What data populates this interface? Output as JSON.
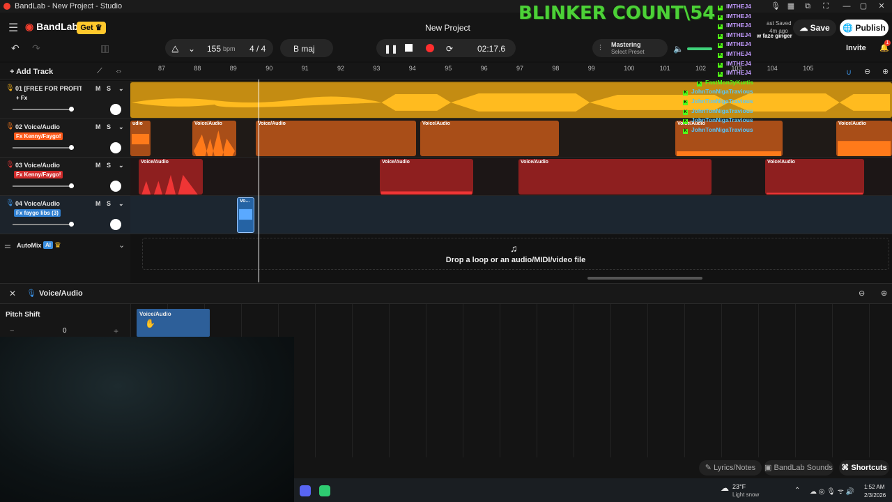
{
  "window": {
    "title": "BandLab - New Project - Studio",
    "min": "—",
    "max": "▢",
    "close": "✕"
  },
  "header": {
    "logo": "BandLab",
    "get_label": "Get",
    "project_title": "New Project",
    "save_label": "Save",
    "publish_label": "Publish",
    "invite_label": "Invite",
    "notif_count": "1",
    "saved_text": "ast Saved",
    "saved_time": "4m ago"
  },
  "transport": {
    "tempo": "155",
    "tempo_unit": "bpm",
    "time_sig": "4 / 4",
    "key": "B maj",
    "time": "02:17.6",
    "mastering_title": "Mastering",
    "mastering_sub": "Select Preset"
  },
  "ruler": {
    "add_track": "Add Track",
    "bars": [
      "87",
      "88",
      "89",
      "90",
      "91",
      "92",
      "93",
      "94",
      "95",
      "96",
      "97",
      "98",
      "99",
      "100",
      "101",
      "102",
      "103",
      "104",
      "105"
    ]
  },
  "tracks": [
    {
      "name": "01  [FREE FOR PROFIT] ...",
      "fx": "+ Fx",
      "color": "#f5b21a",
      "m": "M",
      "s": "S"
    },
    {
      "name": "02  Voice/Audio",
      "fx": "Fx  Kenny/Faygo!",
      "color": "#ff7a1a",
      "m": "M",
      "s": "S"
    },
    {
      "name": "03  Voice/Audio",
      "fx": "Fx  Kenny/Faygo!",
      "color": "#e23434",
      "m": "M",
      "s": "S"
    },
    {
      "name": "04  Voice/Audio",
      "fx": "Fx  faygo libs (3)",
      "color": "#3a8fe0",
      "m": "M",
      "s": "S"
    }
  ],
  "clip_label": "Voice/Audio",
  "clip_label_short": "Vo...",
  "clip_fragment": "udio",
  "automix": {
    "label": "AutoMix",
    "badge": "AI"
  },
  "drop_text": "Drop a loop or an audio/MIDI/video file",
  "editor": {
    "track": "Voice/Audio",
    "param": "Pitch Shift",
    "value": "0",
    "minus": "−",
    "plus": "+",
    "clip": "Voice/Audio"
  },
  "bottom": {
    "lyrics": "Lyrics/Notes",
    "sounds": "BandLab Sounds",
    "shortcuts": "Shortcuts"
  },
  "taskbar": {
    "temp": "23°F",
    "weather": "Light snow",
    "time": "1:52 AM",
    "date": "2/3/2026"
  },
  "overlay": {
    "blinker": "BLINKER COUNT\\54",
    "chat": [
      {
        "user": "IMTHEJ4",
        "color": "#c39bff"
      },
      {
        "user": "IMTHEJ4",
        "color": "#c39bff"
      },
      {
        "user": "IMTHEJ4",
        "color": "#c39bff"
      },
      {
        "user": "IMTHEJ4",
        "color": "#c39bff"
      },
      {
        "user": "IMTHEJ4",
        "color": "#c39bff"
      },
      {
        "user": "IMTHEJ4",
        "color": "#c39bff"
      },
      {
        "user": "IMTHEJ4",
        "color": "#c39bff"
      },
      {
        "user": "IMTHEJ4",
        "color": "#c39bff"
      },
      {
        "user": "FastMon3yKurtis",
        "color": "#53fc18"
      },
      {
        "user": "JohnTonNigaTravious",
        "color": "#56c7ff"
      },
      {
        "user": "JohnTonNigaTravious",
        "color": "#56c7ff"
      },
      {
        "user": "JohnTonNigaTravious",
        "color": "#56c7ff"
      },
      {
        "user": "JohnTonNigaTravious",
        "color": "#56c7ff"
      },
      {
        "user": "JohnTonNigaTravious",
        "color": "#56c7ff"
      }
    ],
    "chat_msg": "w faze ginger"
  }
}
